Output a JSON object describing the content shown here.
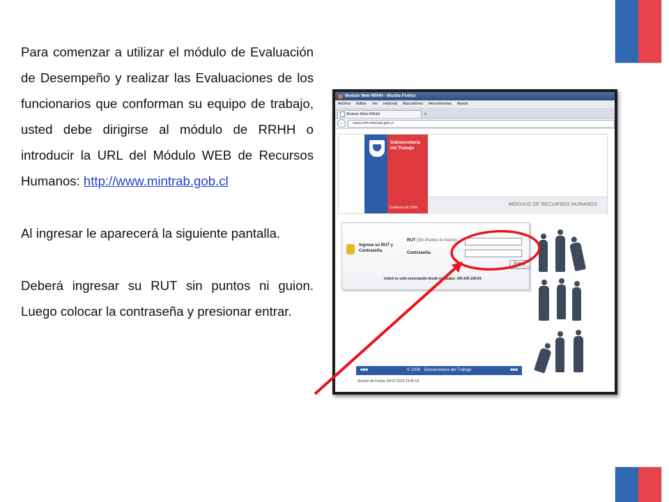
{
  "instructions": {
    "para1_text": "Para comenzar a utilizar el módulo de Evaluación de Desempeño y realizar las Evaluaciones de los funcionarios que conforman su equipo de trabajo, usted debe dirigirse al módulo de RRHH o introducir la URL del Módulo WEB de Recursos Humanos:",
    "para1_link": "http://www.mintrab.gob.cl",
    "para2": "Al ingresar le aparecerá la siguiente pantalla.",
    "para3": "Deberá ingresar su RUT sin puntos ni guion. Luego colocar la contraseña y presionar entrar."
  },
  "browser": {
    "window_title": "Modulo Web RRHH - Mozilla Firefox",
    "menu": [
      "Archivo",
      "Editar",
      "Ver",
      "Historial",
      "Marcadores",
      "Herramientas",
      "Ayuda"
    ],
    "tab_label": "Modulo Web RRHH",
    "new_tab": "+",
    "back": "←",
    "url": "www.rrhh.mintrab.gob.cl"
  },
  "page": {
    "org_name": "Subsecretaria del Trabajo",
    "gov_label": "Gobierno de Chile",
    "module_title": "MÓDULO DE RECURSOS HUMANOS",
    "login": {
      "prompt": "Ingrese su RUT y Contraseña.",
      "rut_label": "RUT",
      "rut_note": "(Sin Puntos ni Guión):",
      "password_label": "Contraseña:",
      "submit_label": "Entrar",
      "connection_text": "Usted se está conectando desde el Equipo: 100.100.100.94."
    },
    "footer": {
      "left": "■■■",
      "year": "© 2009",
      "org": "Subsecretaria del Trabajo",
      "right": "■■■",
      "version": "Versión de Fecha: 24-07-2012 13:45:19"
    }
  },
  "colors": {
    "flag_blue": "#2f67b0",
    "flag_red": "#e8424a",
    "annotation_red": "#e8141c",
    "link_blue": "#1f3fd1"
  }
}
